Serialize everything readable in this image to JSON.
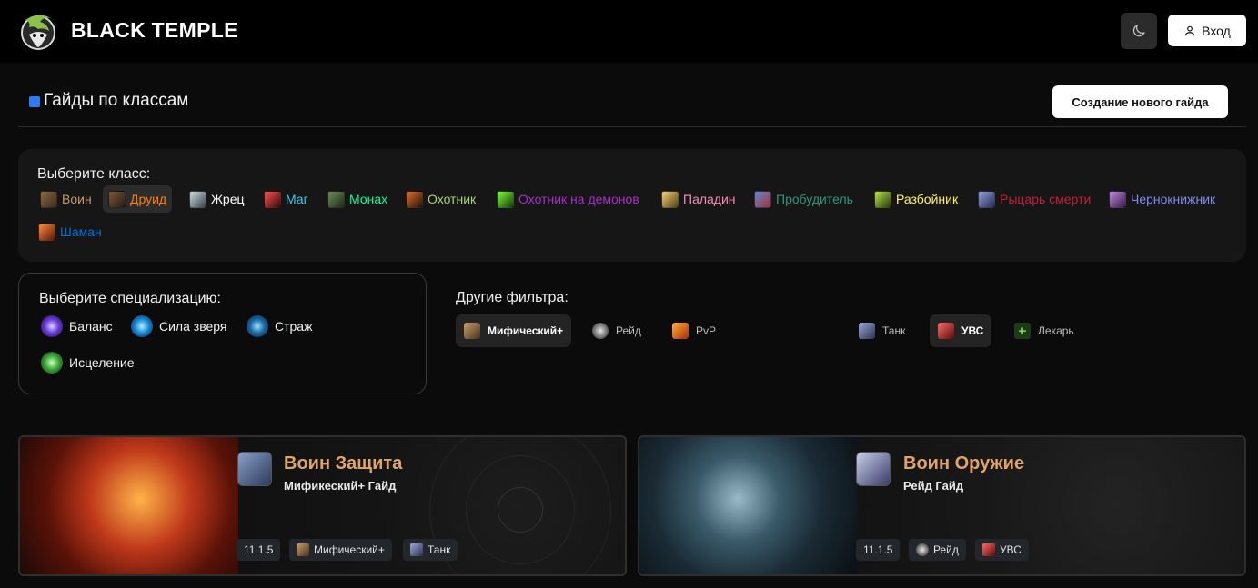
{
  "header": {
    "brand": "BLACK TEMPLE",
    "theme_icon": "moon-icon",
    "login_label": "Вход",
    "login_icon": "user-icon"
  },
  "page": {
    "title": "Гайды по классам",
    "create_button": "Создание нового гайда"
  },
  "classes": {
    "label": "Выберите класс:",
    "selected": "Друид",
    "items": [
      {
        "label": "Воин",
        "color": "#c69b6d"
      },
      {
        "label": "Друид",
        "color": "#ff7c0a"
      },
      {
        "label": "Жрец",
        "color": "#ffffff"
      },
      {
        "label": "Маг",
        "color": "#3fc7eb"
      },
      {
        "label": "Монах",
        "color": "#00ff98"
      },
      {
        "label": "Охотник",
        "color": "#aad372"
      },
      {
        "label": "Охотник на демонов",
        "color": "#a330c9"
      },
      {
        "label": "Паладин",
        "color": "#f48cba"
      },
      {
        "label": "Пробудитель",
        "color": "#33937f"
      },
      {
        "label": "Разбойник",
        "color": "#fff468"
      },
      {
        "label": "Рыцарь смерти",
        "color": "#c41e3a"
      },
      {
        "label": "Чернокнижник",
        "color": "#8788ee"
      },
      {
        "label": "Шаман",
        "color": "#0070dd"
      }
    ]
  },
  "specs": {
    "label": "Выберите специализацию:",
    "items": [
      {
        "label": "Баланс"
      },
      {
        "label": "Сила зверя"
      },
      {
        "label": "Страж"
      },
      {
        "label": "Исцеление"
      }
    ]
  },
  "filters": {
    "label": "Другие фильтра:",
    "items": [
      {
        "label": "Мифический+",
        "active": true,
        "icon": "mythic-key-icon"
      },
      {
        "label": "Рейд",
        "active": false,
        "icon": "skull-icon"
      },
      {
        "label": "PvP",
        "active": false,
        "icon": "pvp-icon"
      },
      {
        "label": "Танк",
        "active": false,
        "icon": "shield-icon"
      },
      {
        "label": "УВС",
        "active": true,
        "icon": "sword-icon"
      },
      {
        "label": "Лекарь",
        "active": false,
        "icon": "plus-icon"
      }
    ]
  },
  "guides": [
    {
      "title": "Воин Защита",
      "subtitle": "Мификеский+ Гайд",
      "tags": [
        "11.1.5",
        "Мифический+",
        "Танк"
      ]
    },
    {
      "title": "Воин Оружие",
      "subtitle": "Рейд Гайд",
      "tags": [
        "11.1.5",
        "Рейд",
        "УВС"
      ]
    }
  ]
}
